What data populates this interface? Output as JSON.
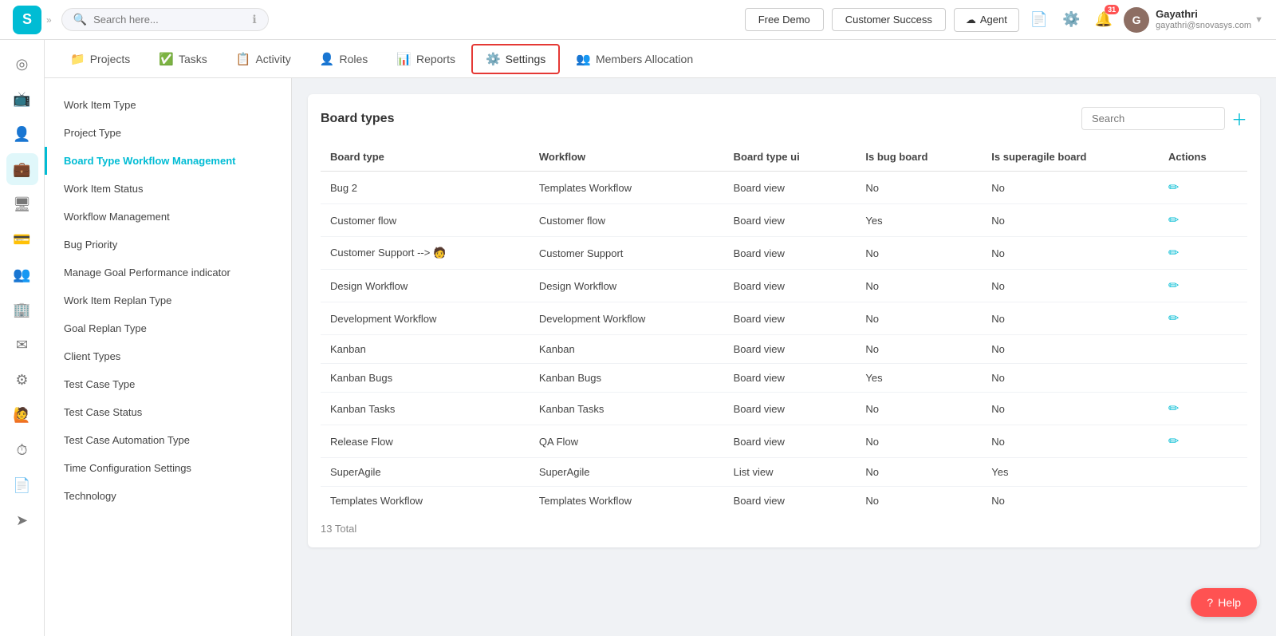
{
  "topbar": {
    "logo_text": "S",
    "search_placeholder": "Search here...",
    "free_demo_label": "Free Demo",
    "customer_success_label": "Customer Success",
    "agent_label": "Agent",
    "notif_count": "31",
    "user_name": "Gayathri",
    "user_email": "gayathri@snovasys.com",
    "user_avatar_initials": "G"
  },
  "tabs": [
    {
      "id": "projects",
      "label": "Projects",
      "icon": "📁"
    },
    {
      "id": "tasks",
      "label": "Tasks",
      "icon": "✅"
    },
    {
      "id": "activity",
      "label": "Activity",
      "icon": "📋"
    },
    {
      "id": "roles",
      "label": "Roles",
      "icon": "👤"
    },
    {
      "id": "reports",
      "label": "Reports",
      "icon": "📊"
    },
    {
      "id": "settings",
      "label": "Settings",
      "icon": "⚙️",
      "active": true
    },
    {
      "id": "members-allocation",
      "label": "Members Allocation",
      "icon": "👥"
    }
  ],
  "sidebar_icons": [
    {
      "id": "home",
      "icon": "⊙",
      "active": false
    },
    {
      "id": "tv",
      "icon": "📺",
      "active": false
    },
    {
      "id": "user",
      "icon": "👤",
      "active": false
    },
    {
      "id": "briefcase",
      "icon": "💼",
      "active": true
    },
    {
      "id": "monitor",
      "icon": "🖥",
      "active": false
    },
    {
      "id": "card",
      "icon": "💳",
      "active": false
    },
    {
      "id": "people",
      "icon": "👥",
      "active": false
    },
    {
      "id": "group",
      "icon": "🏢",
      "active": false
    },
    {
      "id": "mail",
      "icon": "✉️",
      "active": false
    },
    {
      "id": "settings",
      "icon": "⚙️",
      "active": false
    },
    {
      "id": "person",
      "icon": "🙋",
      "active": false
    },
    {
      "id": "clock",
      "icon": "🕐",
      "active": false
    },
    {
      "id": "doc",
      "icon": "📄",
      "active": false
    },
    {
      "id": "send",
      "icon": "📨",
      "active": false
    }
  ],
  "settings_menu": [
    {
      "id": "work-item-type",
      "label": "Work Item Type"
    },
    {
      "id": "project-type",
      "label": "Project Type"
    },
    {
      "id": "board-type-workflow-management",
      "label": "Board Type Workflow Management",
      "active": true
    },
    {
      "id": "work-item-status",
      "label": "Work Item Status"
    },
    {
      "id": "workflow-management",
      "label": "Workflow Management"
    },
    {
      "id": "bug-priority",
      "label": "Bug Priority"
    },
    {
      "id": "manage-goal-performance-indicator",
      "label": "Manage Goal Performance indicator"
    },
    {
      "id": "work-item-replan-type",
      "label": "Work Item Replan Type"
    },
    {
      "id": "goal-replan-type",
      "label": "Goal Replan Type"
    },
    {
      "id": "client-types",
      "label": "Client Types"
    },
    {
      "id": "test-case-type",
      "label": "Test Case Type"
    },
    {
      "id": "test-case-status",
      "label": "Test Case Status"
    },
    {
      "id": "test-case-automation-type",
      "label": "Test Case Automation Type"
    },
    {
      "id": "time-configuration-settings",
      "label": "Time Configuration Settings"
    },
    {
      "id": "technology",
      "label": "Technology"
    }
  ],
  "board_types": {
    "title": "Board types",
    "search_placeholder": "Search",
    "total_label": "13 Total",
    "columns": [
      {
        "id": "board-type",
        "label": "Board type"
      },
      {
        "id": "workflow",
        "label": "Workflow"
      },
      {
        "id": "board-type-ui",
        "label": "Board type ui"
      },
      {
        "id": "is-bug-board",
        "label": "Is bug board"
      },
      {
        "id": "is-superagile-board",
        "label": "Is superagile board"
      },
      {
        "id": "actions",
        "label": "Actions"
      }
    ],
    "rows": [
      {
        "board_type": "Bug 2",
        "workflow": "Templates Workflow",
        "board_type_ui": "Board view",
        "is_bug_board": "No",
        "is_superagile_board": "No",
        "has_edit": true
      },
      {
        "board_type": "Customer flow",
        "workflow": "Customer flow",
        "board_type_ui": "Board view",
        "is_bug_board": "Yes",
        "is_superagile_board": "No",
        "has_edit": true
      },
      {
        "board_type": "Customer Support --> 🧑",
        "workflow": "Customer Support",
        "board_type_ui": "Board view",
        "is_bug_board": "No",
        "is_superagile_board": "No",
        "has_edit": true
      },
      {
        "board_type": "Design Workflow",
        "workflow": "Design Workflow",
        "board_type_ui": "Board view",
        "is_bug_board": "No",
        "is_superagile_board": "No",
        "has_edit": true
      },
      {
        "board_type": "Development Workflow",
        "workflow": "Development Workflow",
        "board_type_ui": "Board view",
        "is_bug_board": "No",
        "is_superagile_board": "No",
        "has_edit": true
      },
      {
        "board_type": "Kanban",
        "workflow": "Kanban",
        "board_type_ui": "Board view",
        "is_bug_board": "No",
        "is_superagile_board": "No",
        "has_edit": false
      },
      {
        "board_type": "Kanban Bugs",
        "workflow": "Kanban Bugs",
        "board_type_ui": "Board view",
        "is_bug_board": "Yes",
        "is_superagile_board": "No",
        "has_edit": false
      },
      {
        "board_type": "Kanban Tasks",
        "workflow": "Kanban Tasks",
        "board_type_ui": "Board view",
        "is_bug_board": "No",
        "is_superagile_board": "No",
        "has_edit": true
      },
      {
        "board_type": "Release Flow",
        "workflow": "QA Flow",
        "board_type_ui": "Board view",
        "is_bug_board": "No",
        "is_superagile_board": "No",
        "has_edit": true
      },
      {
        "board_type": "SuperAgile",
        "workflow": "SuperAgile",
        "board_type_ui": "List view",
        "is_bug_board": "No",
        "is_superagile_board": "Yes",
        "has_edit": false
      },
      {
        "board_type": "Templates Workflow",
        "workflow": "Templates Workflow",
        "board_type_ui": "Board view",
        "is_bug_board": "No",
        "is_superagile_board": "No",
        "has_edit": false
      }
    ]
  },
  "help_btn_label": "Help"
}
